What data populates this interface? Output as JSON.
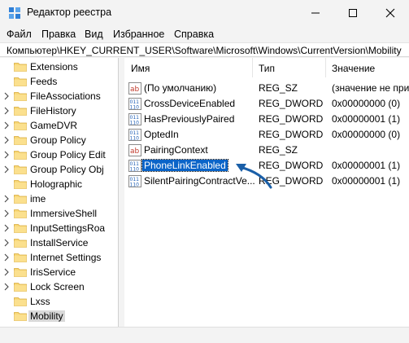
{
  "window": {
    "title": "Редактор реестра"
  },
  "menu": [
    "Файл",
    "Правка",
    "Вид",
    "Избранное",
    "Справка"
  ],
  "address": "Компьютер\\HKEY_CURRENT_USER\\Software\\Microsoft\\Windows\\CurrentVersion\\Mobility",
  "tree": {
    "items": [
      {
        "label": "Extensions",
        "expandable": false
      },
      {
        "label": "Feeds",
        "expandable": false
      },
      {
        "label": "FileAssociations",
        "expandable": true
      },
      {
        "label": "FileHistory",
        "expandable": true
      },
      {
        "label": "GameDVR",
        "expandable": true
      },
      {
        "label": "Group Policy",
        "expandable": true
      },
      {
        "label": "Group Policy Edit",
        "expandable": true
      },
      {
        "label": "Group Policy Obj",
        "expandable": true
      },
      {
        "label": "Holographic",
        "expandable": false
      },
      {
        "label": "ime",
        "expandable": true
      },
      {
        "label": "ImmersiveShell",
        "expandable": true
      },
      {
        "label": "InputSettingsRoa",
        "expandable": true
      },
      {
        "label": "InstallService",
        "expandable": true
      },
      {
        "label": "Internet Settings",
        "expandable": true
      },
      {
        "label": "IrisService",
        "expandable": true
      },
      {
        "label": "Lock Screen",
        "expandable": true
      },
      {
        "label": "Lxss",
        "expandable": false
      },
      {
        "label": "Mobility",
        "expandable": false,
        "selected": true
      }
    ]
  },
  "values": {
    "headers": {
      "name": "Имя",
      "type": "Тип",
      "data": "Значение"
    },
    "rows": [
      {
        "icon": "string-value-icon",
        "name": "(По умолчанию)",
        "type": "REG_SZ",
        "data": "(значение не присвоено)"
      },
      {
        "icon": "binary-value-icon",
        "name": "CrossDeviceEnabled",
        "type": "REG_DWORD",
        "data": "0x00000000 (0)"
      },
      {
        "icon": "binary-value-icon",
        "name": "HasPreviouslyPaired",
        "type": "REG_DWORD",
        "data": "0x00000001 (1)"
      },
      {
        "icon": "binary-value-icon",
        "name": "OptedIn",
        "type": "REG_DWORD",
        "data": "0x00000000 (0)"
      },
      {
        "icon": "string-value-icon",
        "name": "PairingContext",
        "type": "REG_SZ",
        "data": ""
      },
      {
        "icon": "binary-value-icon",
        "name": "PhoneLinkEnabled",
        "type": "REG_DWORD",
        "data": "0x00000001 (1)",
        "selected": true
      },
      {
        "icon": "binary-value-icon",
        "name": "SilentPairingContractVe...",
        "type": "REG_DWORD",
        "data": "0x00000001 (1)"
      }
    ]
  },
  "colors": {
    "selection": "#0a64c8",
    "arrow": "#1a5fa8",
    "folder": "#f8d775"
  }
}
